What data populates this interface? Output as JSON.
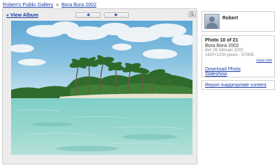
{
  "breadcrumb": {
    "gallery": "Robert's Public Gallery",
    "separator": "»",
    "album": "Bora Bora 2002"
  },
  "viewer": {
    "view_album": "« View Album",
    "prev_glyph": "◀",
    "next_glyph": "▶",
    "image_alt": "Beach with palm trees and turquoise lagoon"
  },
  "profile": {
    "name": "Robert"
  },
  "photo_info": {
    "count": "Photo 10 of 21",
    "album": "Bora Bora 2002",
    "date": "den 26 februari 2002",
    "size": "1600×1200 pixels - 570KB",
    "more_info": "more info",
    "download": "Download Photo",
    "slideshow": "Slideshow"
  },
  "report": {
    "label": "Report inappropriate content"
  },
  "colors": {
    "link": "#1a3ba6",
    "panel_bg": "#ececec",
    "border": "#cfcfcf"
  }
}
